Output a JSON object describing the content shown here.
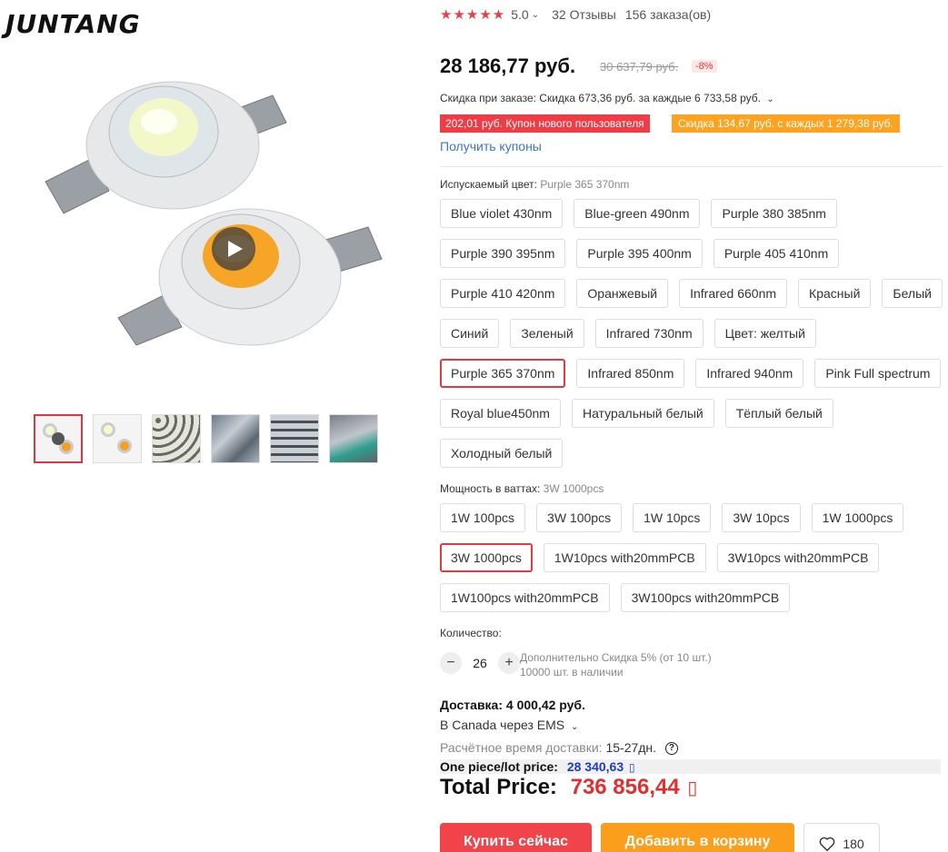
{
  "brand": "JUNTANG",
  "rating": {
    "stars": "★★★★★",
    "score": "5.0",
    "reviews": "32 Отзывы",
    "orders": "156 заказа(ов)"
  },
  "price": {
    "current": "28 186,77 руб.",
    "old": "30 637,79 руб.",
    "discount_pct": "-8%"
  },
  "order_discount": "Скидка при заказе: Скидка 673,36 руб. за каждые 6 733,58 руб.",
  "coupons": {
    "new_user": "202,01 руб. Купон нового пользователя",
    "store": "Скидка 134,67 руб. с каждых 1 279,38 руб.",
    "get_link": "Получить купоны"
  },
  "color_prop": {
    "label": "Испускаемый цвет:",
    "selected": "Purple 365 370nm",
    "options": [
      "Blue violet 430nm",
      "Blue-green 490nm",
      "Purple 380 385nm",
      "Purple 390 395nm",
      "Purple 395 400nm",
      "Purple 405 410nm",
      "Purple 410 420nm",
      "Оранжевый",
      "Infrared 660nm",
      "Красный",
      "Белый",
      "Синий",
      "Зеленый",
      "Infrared 730nm",
      "Цвет: желтый",
      "Purple 365 370nm",
      "Infrared 850nm",
      "Infrared 940nm",
      "Pink Full spectrum",
      "Royal blue450nm",
      "Натуральный белый",
      "Тёплый белый",
      "Холодный белый"
    ]
  },
  "power_prop": {
    "label": "Мощность в ваттах:",
    "selected": "3W 1000pcs",
    "options": [
      "1W 100pcs",
      "3W 100pcs",
      "1W 10pcs",
      "3W 10pcs",
      "1W 1000pcs",
      "3W 1000pcs",
      "1W10pcs with20mmPCB",
      "3W10pcs with20mmPCB",
      "1W100pcs with20mmPCB",
      "3W100pcs with20mmPCB"
    ]
  },
  "quantity": {
    "label": "Количество:",
    "value": "26",
    "note_discount": "Дополнительно Скидка 5% (от 10 шт.)",
    "note_stock": "10000 шт. в наличии"
  },
  "shipping": {
    "title": "Доставка: 4 000,42 руб.",
    "via": "В Canada через EMS",
    "time_label": "Расчётное время доставки:",
    "time_value": "15-27дн."
  },
  "one_piece": {
    "label": "One piece/lot price:",
    "value": "28 340,63"
  },
  "total": {
    "label": "Total Price:",
    "value": "736 856,44"
  },
  "actions": {
    "buy": "Купить сейчас",
    "cart": "Добавить в корзину",
    "wish_count": "180"
  },
  "colors": {
    "accent_red": "#f0434a",
    "accent_orange": "#fb9e1c",
    "link_blue": "#3a77c8"
  }
}
